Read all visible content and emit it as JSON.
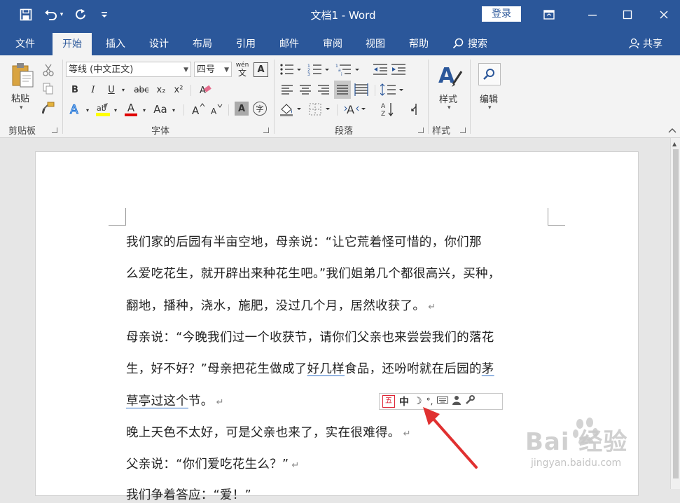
{
  "titlebar": {
    "doc_title": "文档1  -  Word",
    "login_label": "登录",
    "save_icon": "save-icon",
    "undo_icon": "undo-icon",
    "redo_icon": "redo-icon",
    "qat_icon": "customize-qat-icon"
  },
  "tabs": [
    "文件",
    "开始",
    "插入",
    "设计",
    "布局",
    "引用",
    "邮件",
    "审阅",
    "视图",
    "帮助"
  ],
  "search_label": "搜索",
  "share_label": "共享",
  "ribbon": {
    "clipboard": {
      "paste_label": "粘贴",
      "group_label": "剪贴板"
    },
    "font": {
      "font_name": "等线 (中文正文)",
      "font_size": "四号",
      "wen": "wén",
      "wen_char": "文",
      "a_box": "A",
      "bold": "B",
      "italic": "I",
      "underline": "U",
      "strike": "abc",
      "sub": "x₂",
      "sup": "x²",
      "font_color": "A",
      "aa_label": "Aa",
      "grow": "A^",
      "shrink": "Aˇ",
      "char_shade": "A",
      "enclose": "字",
      "group_label": "字体"
    },
    "paragraph": {
      "group_label": "段落"
    },
    "styles": {
      "label": "样式",
      "group_label": "样式"
    },
    "editing": {
      "label": "编辑"
    }
  },
  "document": {
    "paragraphs": [
      {
        "pre": "      我们家的后园有半亩空地，母亲说：“让它荒着怪可惜的，你们那",
        "u": "",
        "post": "",
        "mark": false
      },
      {
        "pre": "么爱吃花生，就开辟出来种花生吧。”我们姐弟几个都很高兴，买种，",
        "u": "",
        "post": "",
        "mark": false
      },
      {
        "pre": "翻地，播种，浇水，施肥，没过几个月，居然收获了。",
        "u": "",
        "post": "",
        "mark": true
      },
      {
        "pre": "母亲说：“今晚我们过一个收获节，请你们父亲也来尝尝我们的落花",
        "u": "",
        "post": "",
        "mark": false
      },
      {
        "pre": "生，好不好？”母亲把花生做成了",
        "u": "好几样",
        "post": "食品，还吩咐就在后园的",
        "u2": "茅",
        "mark": false
      },
      {
        "pre": "",
        "u": "草亭过这个",
        "post": "节。",
        "mark": true
      },
      {
        "pre": "晚上天色不太好，可是父亲也来了，实在很难得。",
        "u": "",
        "post": "",
        "mark": true
      },
      {
        "pre": "父亲说：“你们爱吃花生么？”",
        "u": "",
        "post": "",
        "mark": true
      },
      {
        "pre": "我们争着答应：“爱！”",
        "u": "",
        "post": "",
        "mark": false
      }
    ],
    "para_mark": "↵"
  },
  "ime": {
    "logo": "五",
    "mode": "中",
    "moon": "☽",
    "punct": "°,"
  },
  "watermark": {
    "brand": "Bai  经验",
    "url": "jingyan.baidu.com"
  },
  "colors": {
    "titlebar": "#2b579a",
    "ribbon": "#f3f3f3",
    "underline": "#2b6cc4",
    "arrow": "#e03030"
  }
}
